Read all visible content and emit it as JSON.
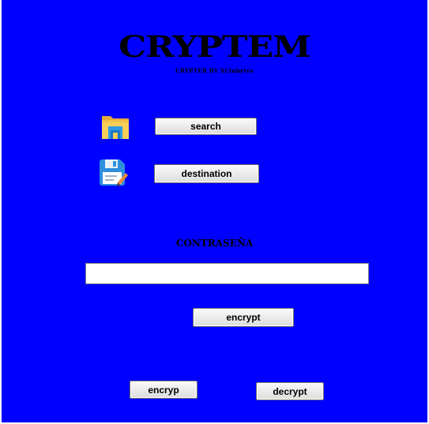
{
  "app": {
    "title": "CRYPTEM",
    "subtitle": "CRYPTER BY Xt3nbytes"
  },
  "buttons": {
    "search": "search",
    "destination": "destination",
    "encrypt": "encrypt",
    "encryp": "encryp",
    "decrypt": "decrypt"
  },
  "password": {
    "label": "CONTRASEÑA",
    "value": "",
    "placeholder": ""
  },
  "icons": {
    "folder": "folder-icon",
    "floppy": "floppy-save-icon"
  },
  "colors": {
    "background": "#0000ff",
    "button": "#e1e1e1"
  }
}
